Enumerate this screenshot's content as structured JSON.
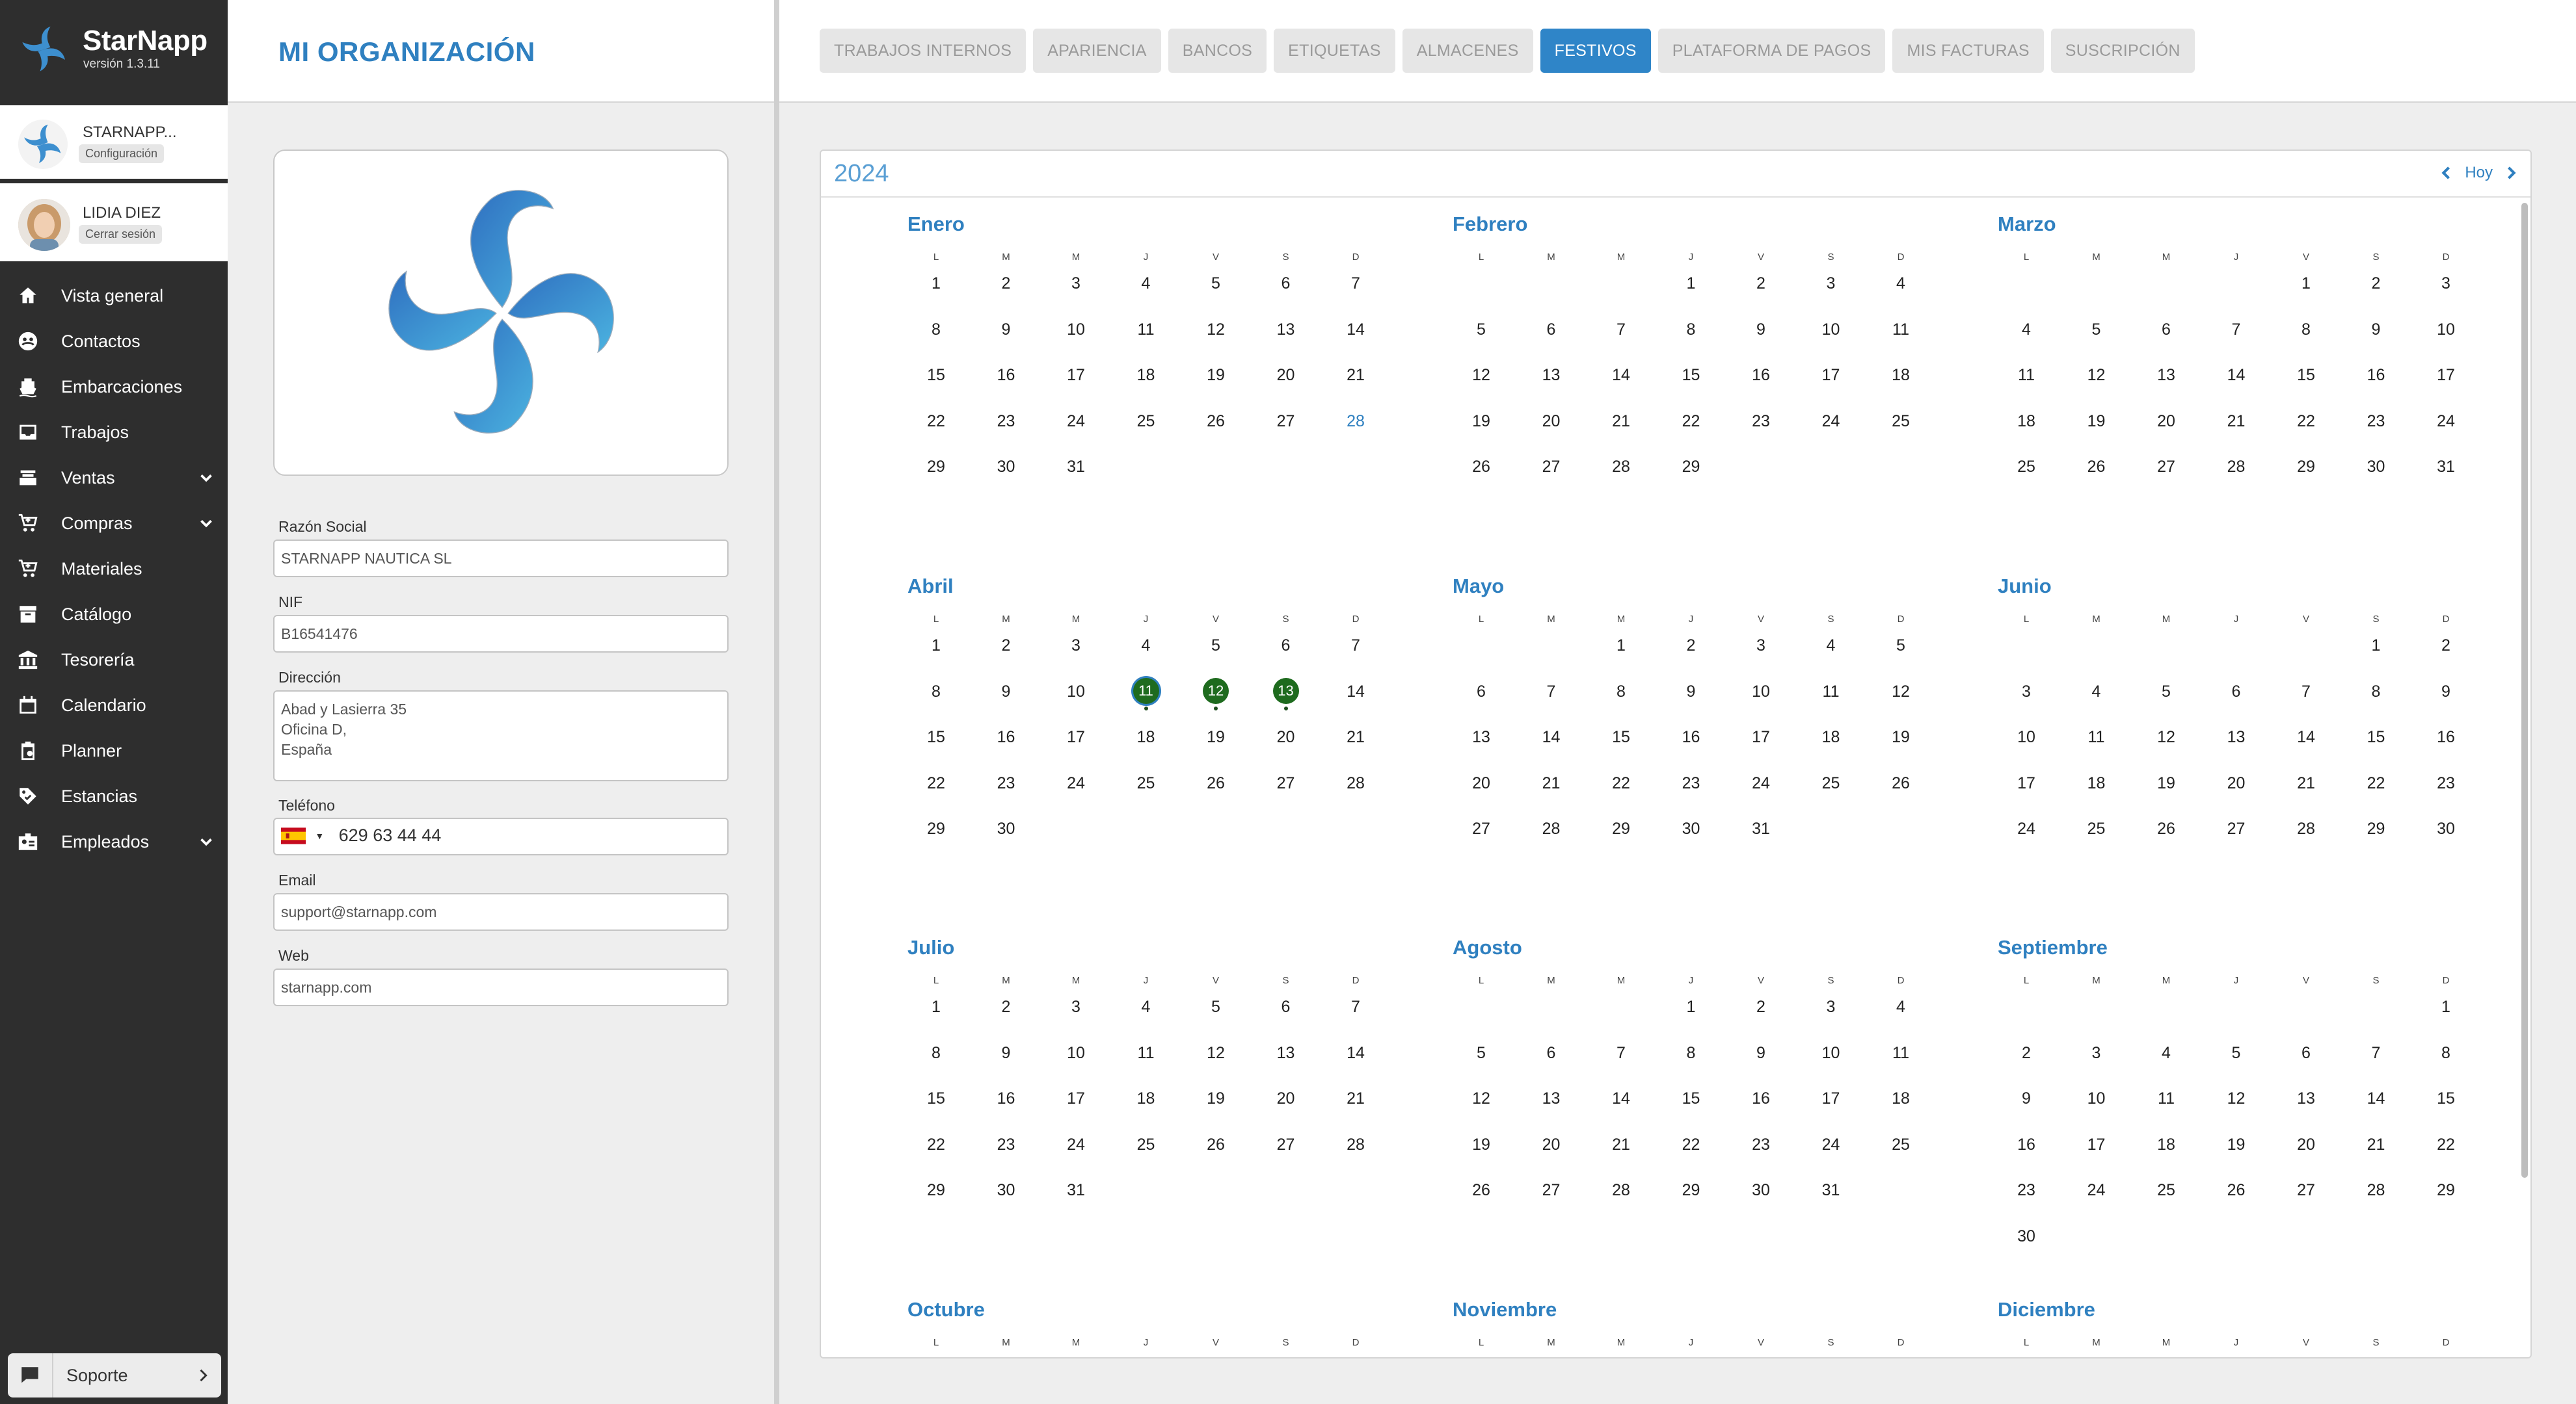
{
  "app": {
    "name": "StarNapp",
    "version": "versión 1.3.11"
  },
  "org_card": {
    "name": "STARNAPP...",
    "link": "Configuración"
  },
  "user_card": {
    "name": "LIDIA DIEZ",
    "link": "Cerrar sesión"
  },
  "nav": [
    {
      "label": "Vista general",
      "icon": "home-icon",
      "expandable": false
    },
    {
      "label": "Contactos",
      "icon": "contacts-icon",
      "expandable": false
    },
    {
      "label": "Embarcaciones",
      "icon": "boat-icon",
      "expandable": false
    },
    {
      "label": "Trabajos",
      "icon": "inbox-icon",
      "expandable": false
    },
    {
      "label": "Ventas",
      "icon": "register-icon",
      "expandable": true
    },
    {
      "label": "Compras",
      "icon": "cart-icon",
      "expandable": true
    },
    {
      "label": "Materiales",
      "icon": "cart-icon",
      "expandable": false
    },
    {
      "label": "Catálogo",
      "icon": "archive-icon",
      "expandable": false
    },
    {
      "label": "Tesorería",
      "icon": "bank-icon",
      "expandable": false
    },
    {
      "label": "Calendario",
      "icon": "calendar-icon",
      "expandable": false
    },
    {
      "label": "Planner",
      "icon": "clipboard-icon",
      "expandable": false
    },
    {
      "label": "Estancias",
      "icon": "tag-icon",
      "expandable": false
    },
    {
      "label": "Empleados",
      "icon": "badge-icon",
      "expandable": true
    }
  ],
  "support": {
    "label": "Soporte"
  },
  "org_page": {
    "title": "MI ORGANIZACIÓN",
    "fields": {
      "razon_social": {
        "label": "Razón Social",
        "value": "STARNAPP NAUTICA SL"
      },
      "nif": {
        "label": "NIF",
        "value": "B16541476"
      },
      "direccion": {
        "label": "Dirección",
        "lines": [
          "Abad y Lasierra 35",
          "Oficina D,",
          "España"
        ]
      },
      "telefono": {
        "label": "Teléfono",
        "value": "629 63 44 44"
      },
      "email": {
        "label": "Email",
        "value": "support@starnapp.com"
      },
      "web": {
        "label": "Web",
        "value": "starnapp.com"
      }
    }
  },
  "tabs": [
    {
      "label": "TRABAJOS INTERNOS",
      "active": false
    },
    {
      "label": "APARIENCIA",
      "active": false
    },
    {
      "label": "BANCOS",
      "active": false
    },
    {
      "label": "ETIQUETAS",
      "active": false
    },
    {
      "label": "ALMACENES",
      "active": false
    },
    {
      "label": "FESTIVOS",
      "active": true
    },
    {
      "label": "PLATAFORMA DE PAGOS",
      "active": false
    },
    {
      "label": "MIS FACTURAS",
      "active": false
    },
    {
      "label": "SUSCRIPCIÓN",
      "active": false
    }
  ],
  "calendar": {
    "year": "2024",
    "today_label": "Hoy",
    "weekdays": [
      "L",
      "M",
      "M",
      "J",
      "V",
      "S",
      "D"
    ],
    "highlight_today": {
      "month": 0,
      "day": 28
    },
    "holidays": [
      {
        "month": 3,
        "day": 11
      },
      {
        "month": 3,
        "day": 12
      },
      {
        "month": 3,
        "day": 13
      }
    ],
    "selected": {
      "month": 3,
      "day": 11
    },
    "months": [
      {
        "name": "Enero",
        "offset": 0,
        "days": 31
      },
      {
        "name": "Febrero",
        "offset": 3,
        "days": 29
      },
      {
        "name": "Marzo",
        "offset": 4,
        "days": 31
      },
      {
        "name": "Abril",
        "offset": 0,
        "days": 30
      },
      {
        "name": "Mayo",
        "offset": 2,
        "days": 31
      },
      {
        "name": "Junio",
        "offset": 5,
        "days": 30
      },
      {
        "name": "Julio",
        "offset": 0,
        "days": 31
      },
      {
        "name": "Agosto",
        "offset": 3,
        "days": 31
      },
      {
        "name": "Septiembre",
        "offset": 6,
        "days": 30
      },
      {
        "name": "Octubre",
        "offset": 1,
        "days": 0
      },
      {
        "name": "Noviembre",
        "offset": 4,
        "days": 0
      },
      {
        "name": "Diciembre",
        "offset": 6,
        "days": 0
      }
    ]
  },
  "colors": {
    "accent": "#2f80c0",
    "sidebar": "#2e2e2e",
    "holiday": "#1e6b1e"
  }
}
